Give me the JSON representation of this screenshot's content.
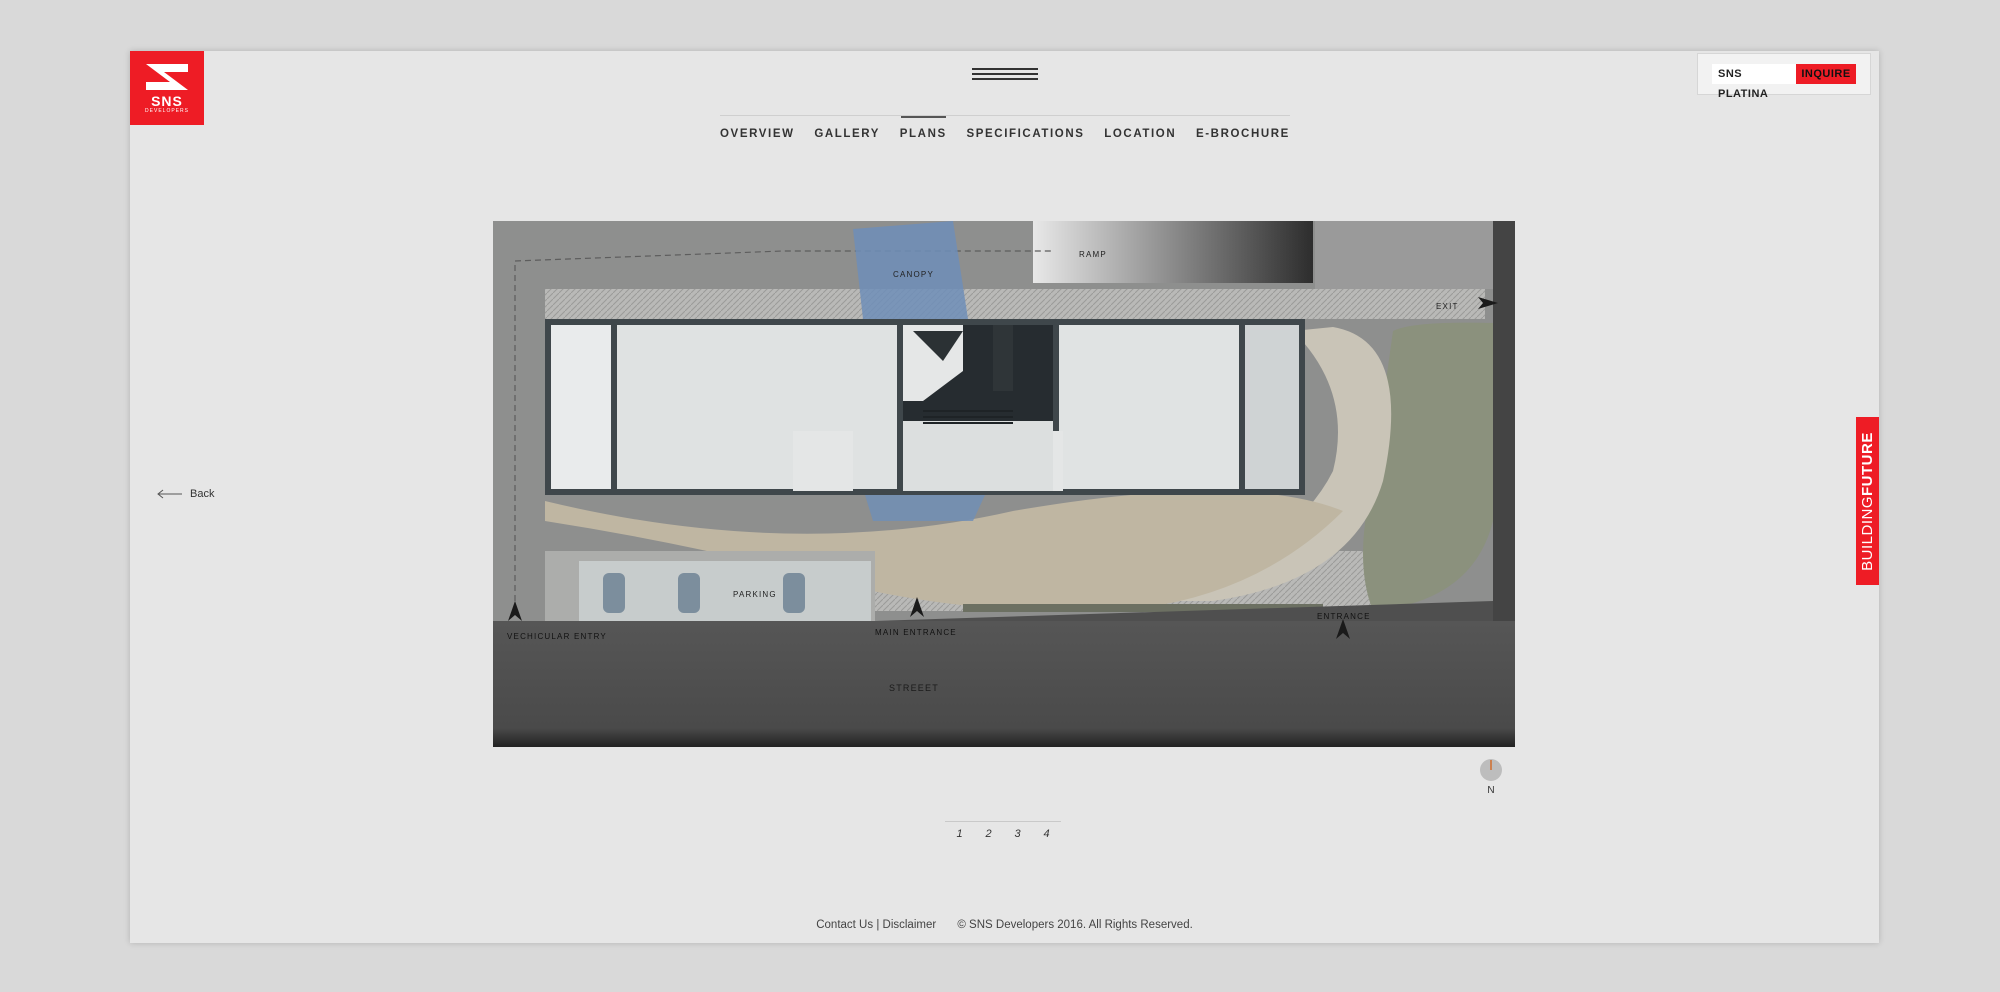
{
  "brand": {
    "logo_word": "SNS",
    "logo_sub": "DEVELOPERS",
    "accent": "#ee1c25"
  },
  "nav": {
    "items": [
      "OVERVIEW",
      "GALLERY",
      "PLANS",
      "SPECIFICATIONS",
      "LOCATION",
      "E-BROCHURE"
    ],
    "active": "PLANS"
  },
  "inquire": {
    "project": "SNS PLATINA",
    "button": "INQUIRE"
  },
  "back_label": "Back",
  "side_tag": {
    "light": "BUILDING",
    "bold": "FUTURE"
  },
  "plan": {
    "labels": {
      "canopy": "CANOPY",
      "ramp": "RAMP",
      "exit": "EXIT",
      "parking": "PARKING",
      "vehicular_entry": "VECHICULAR ENTRY",
      "main_entrance": "MAIN ENTRANCE",
      "entrance": "ENTRANCE",
      "street": "STREEET"
    }
  },
  "compass_label": "N",
  "pager": [
    "1",
    "2",
    "3",
    "4"
  ],
  "footer": {
    "contact": "Contact Us",
    "separator": "|",
    "disclaimer": "Disclaimer",
    "copyright": "© SNS Developers 2016. All Rights Reserved."
  },
  "icons": {
    "menu": "hamburger-icon",
    "back": "arrow-left-icon",
    "compass": "north-compass-icon"
  }
}
